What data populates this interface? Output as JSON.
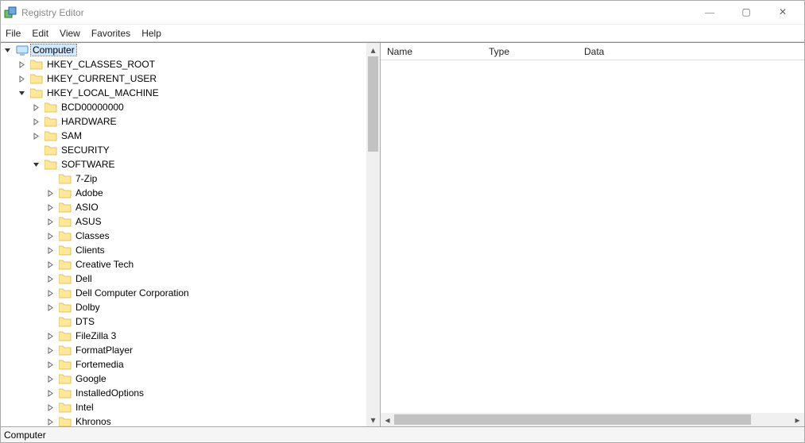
{
  "window": {
    "title": "Registry Editor",
    "controls": {
      "min": "—",
      "max": "▢",
      "close": "✕"
    }
  },
  "menu": {
    "file": "File",
    "edit": "Edit",
    "view": "View",
    "favorites": "Favorites",
    "help": "Help"
  },
  "tree": {
    "root": {
      "label": "Computer",
      "expanded": true,
      "selected": true,
      "type": "computer"
    },
    "hives": [
      {
        "label": "HKEY_CLASSES_ROOT",
        "expanded": false,
        "expander": ">"
      },
      {
        "label": "HKEY_CURRENT_USER",
        "expanded": false,
        "expander": ">"
      },
      {
        "label": "HKEY_LOCAL_MACHINE",
        "expanded": true,
        "expander": "v",
        "children": [
          {
            "label": "BCD00000000",
            "expander": ">"
          },
          {
            "label": "HARDWARE",
            "expander": ">"
          },
          {
            "label": "SAM",
            "expander": ">"
          },
          {
            "label": "SECURITY",
            "expander": ""
          },
          {
            "label": "SOFTWARE",
            "expander": "v",
            "expanded": true,
            "children": [
              {
                "label": "7-Zip",
                "expander": ""
              },
              {
                "label": "Adobe",
                "expander": ">"
              },
              {
                "label": "ASIO",
                "expander": ">"
              },
              {
                "label": "ASUS",
                "expander": ">"
              },
              {
                "label": "Classes",
                "expander": ">"
              },
              {
                "label": "Clients",
                "expander": ">"
              },
              {
                "label": "Creative Tech",
                "expander": ">"
              },
              {
                "label": "Dell",
                "expander": ">"
              },
              {
                "label": "Dell Computer Corporation",
                "expander": ">"
              },
              {
                "label": "Dolby",
                "expander": ">"
              },
              {
                "label": "DTS",
                "expander": ""
              },
              {
                "label": "FileZilla 3",
                "expander": ">"
              },
              {
                "label": "FormatPlayer",
                "expander": ">"
              },
              {
                "label": "Fortemedia",
                "expander": ">"
              },
              {
                "label": "Google",
                "expander": ">"
              },
              {
                "label": "InstalledOptions",
                "expander": ">"
              },
              {
                "label": "Intel",
                "expander": ">"
              },
              {
                "label": "Khronos",
                "expander": ">"
              }
            ]
          }
        ]
      }
    ]
  },
  "list": {
    "columns": {
      "name": "Name",
      "type": "Type",
      "data": "Data"
    },
    "rows": []
  },
  "status": {
    "path": "Computer"
  },
  "glyphs": {
    "chevronRight": "›",
    "chevronDown": "⌄",
    "scrollUp": "▴",
    "scrollDown": "▾",
    "scrollLeft": "◂",
    "scrollRight": "▸"
  }
}
